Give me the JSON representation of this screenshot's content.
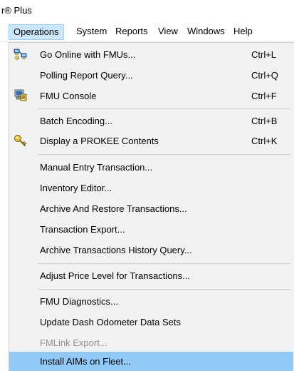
{
  "window": {
    "title_fragment": "r® Plus"
  },
  "menubar": {
    "items": [
      "Operations",
      "System",
      "Reports",
      "View",
      "Windows",
      "Help"
    ]
  },
  "menu": {
    "items": [
      {
        "label": "Go Online with FMUs...",
        "shortcut": "Ctrl+L",
        "icon": "network-computers-icon"
      },
      {
        "label": "Polling Report Query...",
        "shortcut": "Ctrl+Q",
        "icon": ""
      },
      {
        "label": "FMU Console",
        "shortcut": "Ctrl+F",
        "icon": "console-computer-icon"
      },
      {
        "label": "Batch Encoding...",
        "shortcut": "Ctrl+B",
        "icon": ""
      },
      {
        "label": "Display a PROKEE Contents",
        "shortcut": "Ctrl+K",
        "icon": "key-icon"
      },
      {
        "label": "Manual Entry Transaction...",
        "shortcut": "",
        "icon": ""
      },
      {
        "label": "Inventory Editor...",
        "shortcut": "",
        "icon": ""
      },
      {
        "label": "Archive And Restore Transactions...",
        "shortcut": "",
        "icon": ""
      },
      {
        "label": "Transaction Export...",
        "shortcut": "",
        "icon": ""
      },
      {
        "label": "Archive Transactions History Query...",
        "shortcut": "",
        "icon": ""
      },
      {
        "label": "Adjust Price Level for Transactions...",
        "shortcut": "",
        "icon": ""
      },
      {
        "label": "FMU Diagnostics...",
        "shortcut": "",
        "icon": ""
      },
      {
        "label": "Update Dash Odometer Data Sets",
        "shortcut": "",
        "icon": ""
      },
      {
        "label": "FMLink Export...",
        "shortcut": "",
        "icon": "",
        "disabled": true
      },
      {
        "label": "Install AIMs on Fleet...",
        "shortcut": "",
        "icon": "",
        "highlighted": true
      }
    ]
  },
  "colors": {
    "menubar_active_bg": "#cce8ff",
    "highlight_bg": "#91c9f7",
    "disabled_text": "#8f8f8f"
  }
}
